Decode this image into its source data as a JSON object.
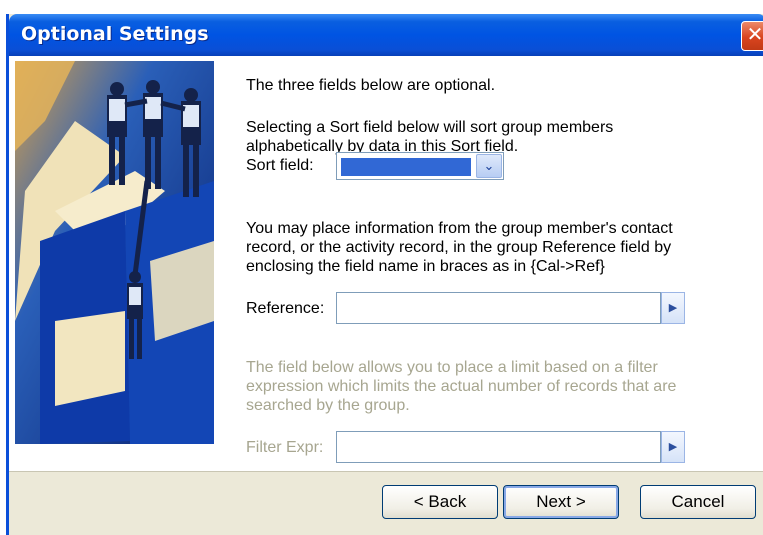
{
  "window": {
    "title": "Optional Settings",
    "close_icon": "✕"
  },
  "content": {
    "intro": "The three fields below are optional.",
    "sort_help": "Selecting a Sort field below will sort group members alphabetically by data in this Sort field.",
    "sort_label": "Sort field:",
    "sort_value": "",
    "reference_help": "You may place information from the group member's contact record, or the activity record, in the group Reference field by enclosing the field name in braces as in {Cal->Ref}",
    "reference_label": "Reference:",
    "reference_value": "",
    "filter_help": "The field below allows you to place a limit based on a filter expression which limits the actual number of records that are searched by the group.",
    "filter_label": "Filter Expr:",
    "filter_value": ""
  },
  "buttons": {
    "back": "< Back",
    "next": "Next >",
    "cancel": "Cancel"
  },
  "icons": {
    "dropdown": "chevron-down-icon",
    "field_picker": "arrow-right-icon"
  },
  "colors": {
    "titlebar": "#0054e3",
    "selection": "#3168d5",
    "disabled_text": "#a7a690"
  }
}
